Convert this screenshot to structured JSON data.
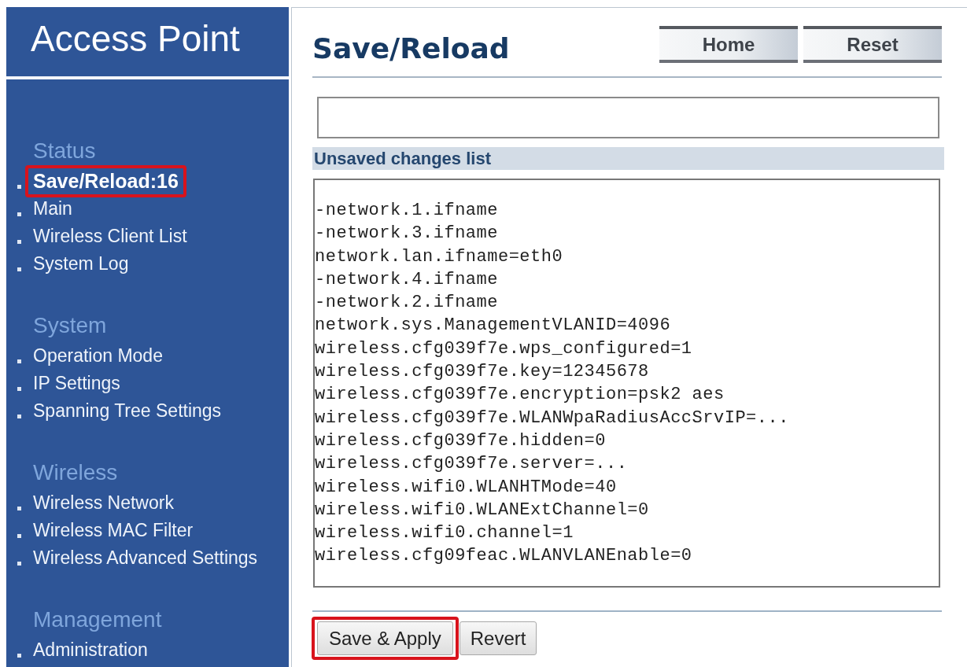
{
  "sidebar": {
    "title": "Access Point",
    "sections": [
      {
        "heading": "Status",
        "items": [
          {
            "label": "Save/Reload:16",
            "selected": true,
            "highlighted": true
          },
          {
            "label": "Main",
            "selected": false,
            "highlighted": false
          },
          {
            "label": "Wireless Client List",
            "selected": false,
            "highlighted": false
          },
          {
            "label": "System Log",
            "selected": false,
            "highlighted": false
          }
        ]
      },
      {
        "heading": "System",
        "items": [
          {
            "label": "Operation Mode",
            "selected": false,
            "highlighted": false
          },
          {
            "label": "IP Settings",
            "selected": false,
            "highlighted": false
          },
          {
            "label": "Spanning Tree Settings",
            "selected": false,
            "highlighted": false
          }
        ]
      },
      {
        "heading": "Wireless",
        "items": [
          {
            "label": "Wireless Network",
            "selected": false,
            "highlighted": false
          },
          {
            "label": "Wireless MAC Filter",
            "selected": false,
            "highlighted": false
          },
          {
            "label": "Wireless Advanced Settings",
            "selected": false,
            "highlighted": false
          }
        ]
      },
      {
        "heading": "Management",
        "items": [
          {
            "label": "Administration",
            "selected": false,
            "highlighted": false
          }
        ]
      }
    ]
  },
  "header": {
    "title": "Save/Reload",
    "buttons": [
      "Home",
      "Reset"
    ]
  },
  "changes": {
    "heading": "Unsaved changes list",
    "lines": [
      "-network.1.ifname",
      "-network.3.ifname",
      "network.lan.ifname=eth0",
      "-network.4.ifname",
      "-network.2.ifname",
      "network.sys.ManagementVLANID=4096",
      "wireless.cfg039f7e.wps_configured=1",
      "wireless.cfg039f7e.key=12345678",
      "wireless.cfg039f7e.encryption=psk2 aes",
      "wireless.cfg039f7e.WLANWpaRadiusAccSrvIP=...",
      "wireless.cfg039f7e.hidden=0",
      "wireless.cfg039f7e.server=...",
      "wireless.wifi0.WLANHTMode=40",
      "wireless.wifi0.WLANExtChannel=0",
      "wireless.wifi0.channel=1",
      "wireless.cfg09feac.WLANVLANEnable=0"
    ]
  },
  "actions": [
    {
      "label": "Save & Apply",
      "highlighted": true
    },
    {
      "label": "Revert",
      "highlighted": false
    }
  ]
}
